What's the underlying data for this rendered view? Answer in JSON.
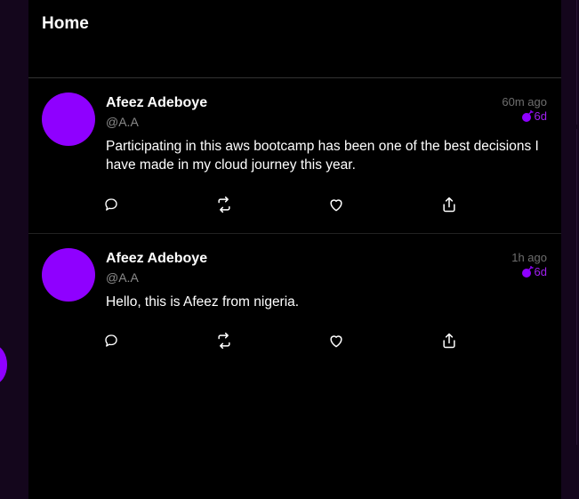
{
  "feed": {
    "title": "Home"
  },
  "posts": [
    {
      "display_name": "Afeez Adeboye",
      "handle": "@A.A",
      "time_ago": "60m ago",
      "expires_in": "6d",
      "message": "Participating in this aws bootcamp has been one of the best decisions I have made in my cloud journey this year."
    },
    {
      "display_name": "Afeez Adeboye",
      "handle": "@A.A",
      "time_ago": "1h ago",
      "expires_in": "6d",
      "message": "Hello, this is Afeez from nigeria."
    }
  ],
  "icons": {
    "reply": "reply-icon",
    "repost": "repost-icon",
    "like": "heart-icon",
    "share": "share-icon",
    "expires": "bomb-icon"
  },
  "colors": {
    "accent": "#8f00ff",
    "expires_text": "#a020f0",
    "background": "#000000",
    "side_background": "#14061c"
  }
}
